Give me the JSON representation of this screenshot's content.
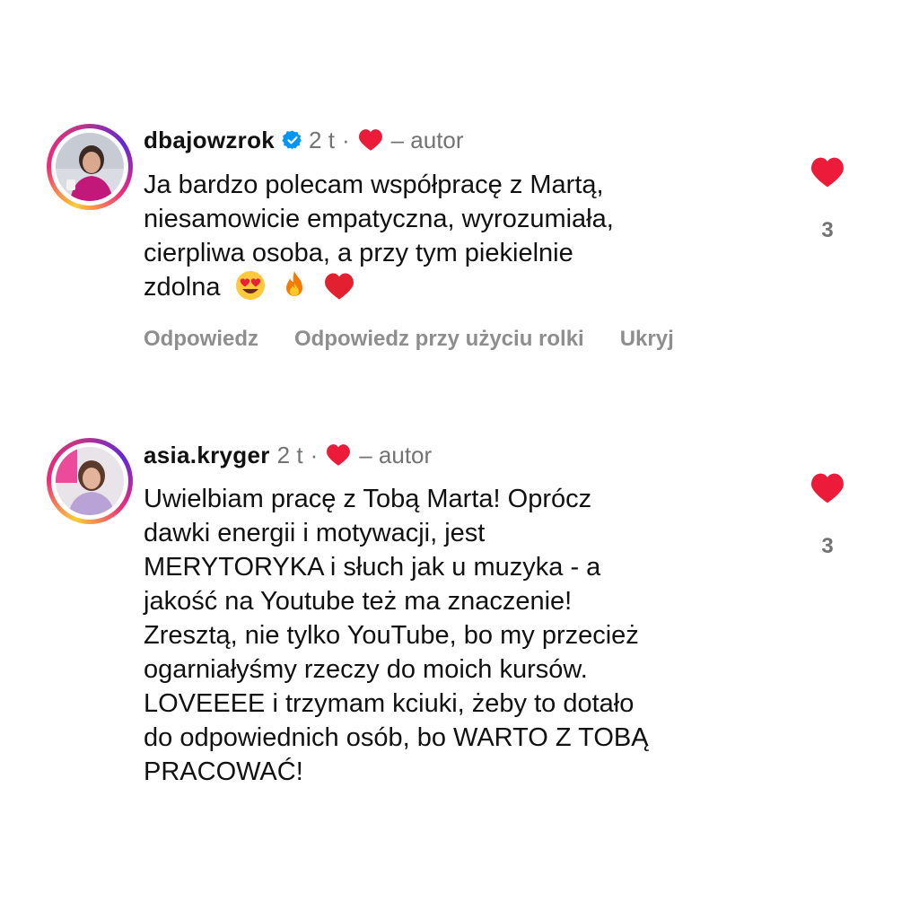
{
  "colors": {
    "heart": "#ed1b3a",
    "verified": "#0095f6",
    "muted": "#737373"
  },
  "comments": [
    {
      "username": "dbajowzrok",
      "verified": true,
      "time": "2 t",
      "separator": "·",
      "author_label": "– autor",
      "lines": [
        "Ja bardzo polecam współpracę z Martą,",
        "niesamowicie empatyczna, wyrozumiała,",
        "cierpliwa osoba, a przy tym piekielnie",
        "zdolna"
      ],
      "emojis": [
        "heart-eyes-emoji",
        "fire-emoji",
        "red-heart-emoji"
      ],
      "actions": [
        "Odpowiedz",
        "Odpowiedz przy użyciu rolki",
        "Ukryj"
      ],
      "like_count": "3",
      "liked": true
    },
    {
      "username": "asia.kryger",
      "verified": false,
      "time": "2 t",
      "separator": "·",
      "author_label": "– autor",
      "lines": [
        "Uwielbiam pracę z Tobą Marta! Oprócz",
        "dawki energii i motywacji, jest",
        "MERYTORYKA i słuch jak u muzyka - a",
        "jakość na Youtube też ma znaczenie!",
        "Zresztą, nie tylko YouTube, bo my przecież",
        "ogarniałyśmy rzeczy do moich kursów.",
        "LOVEEEE i trzymam kciuki, żeby to dotało",
        "do odpowiednich osób, bo WARTO Z TOBĄ",
        "PRACOWAĆ!"
      ],
      "like_count": "3",
      "liked": true
    }
  ]
}
